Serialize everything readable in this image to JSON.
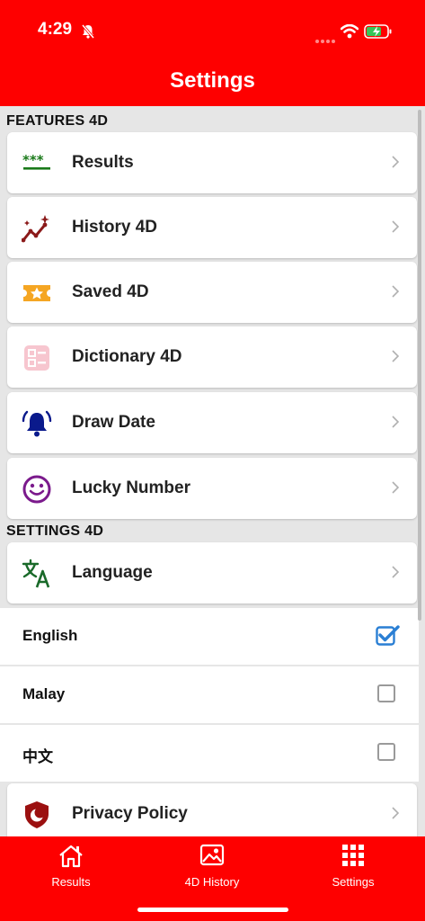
{
  "status_bar": {
    "time": "4:29"
  },
  "header": {
    "title": "Settings"
  },
  "sections": {
    "features": "FEATURES 4D",
    "settings": "SETTINGS 4D"
  },
  "features": [
    {
      "label": "Results",
      "icon": "stars-underline-icon"
    },
    {
      "label": "History 4D",
      "icon": "trend-sparkle-icon"
    },
    {
      "label": "Saved 4D",
      "icon": "ticket-star-icon"
    },
    {
      "label": "Dictionary 4D",
      "icon": "checklist-icon"
    },
    {
      "label": "Draw Date",
      "icon": "alarm-bell-icon"
    },
    {
      "label": "Lucky Number",
      "icon": "smiley-icon"
    }
  ],
  "settings": {
    "language_label": "Language",
    "languages": [
      {
        "label": "English",
        "checked": true
      },
      {
        "label": "Malay",
        "checked": false
      },
      {
        "label": "中文",
        "checked": false
      }
    ],
    "privacy_label": "Privacy Policy"
  },
  "tabbar": {
    "tabs": [
      {
        "label": "Results",
        "icon": "home-icon"
      },
      {
        "label": "4D History",
        "icon": "image-icon"
      },
      {
        "label": "Settings",
        "icon": "grid-icon"
      }
    ]
  },
  "colors": {
    "header": "#fe0000",
    "results_icon": "#1a7a1a",
    "history_icon": "#8b1a1a",
    "saved_icon": "#f5a623",
    "dictionary_icon": "#f7c6cf",
    "drawdate_icon": "#0a1a8c",
    "lucky_icon": "#7b1a8c",
    "language_icon": "#1a6a2a",
    "privacy_icon": "#9b1010",
    "checkbox_checked": "#2a7fd4"
  }
}
